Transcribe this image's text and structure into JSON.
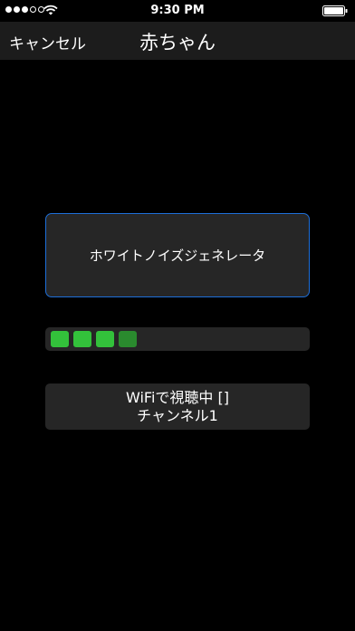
{
  "status_bar": {
    "time": "9:30 PM",
    "signal_strength": 3,
    "signal_max": 5,
    "wifi_icon": "wifi-icon",
    "battery_icon": "battery-icon"
  },
  "nav": {
    "cancel_label": "キャンセル",
    "title": "赤ちゃん"
  },
  "main": {
    "generator_label": "ホワイトノイズジェネレータ",
    "level_meter": {
      "active_segments": 3,
      "dim_segments": 1
    },
    "wifi_status": {
      "line1": "WiFiで視聴中 []",
      "line2": "チャンネル1"
    }
  },
  "colors": {
    "background": "#000000",
    "nav_bar": "#1c1c1c",
    "panel": "#262626",
    "accent_border": "#1d6ed8",
    "level_green": "#33c13b",
    "level_green_dim": "#2a8a2e"
  }
}
